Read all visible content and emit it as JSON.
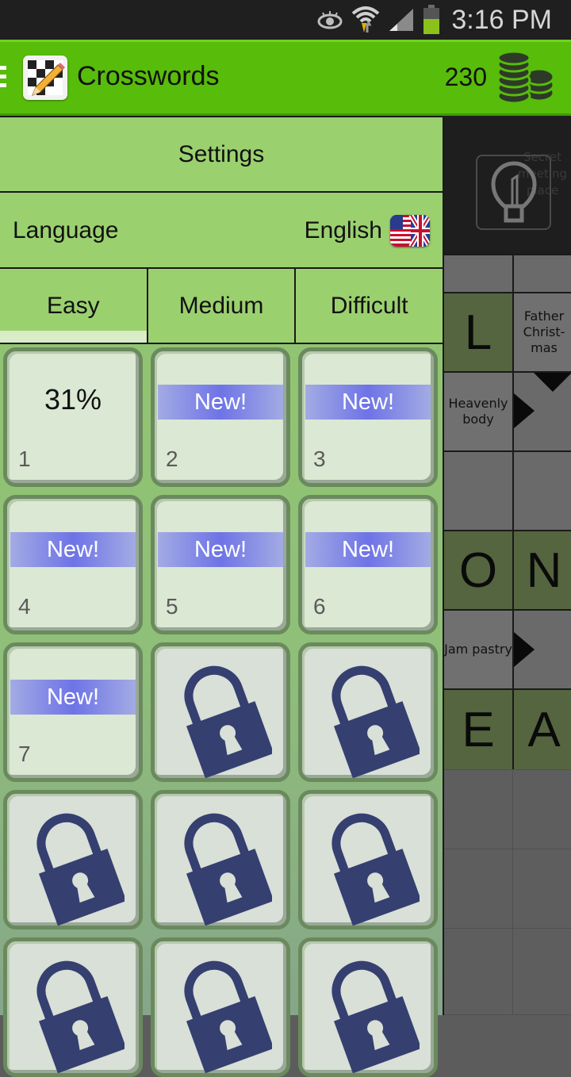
{
  "status_bar": {
    "time": "3:16 PM",
    "icons": [
      "eye-icon",
      "wifi-icon",
      "signal-icon",
      "battery-icon"
    ]
  },
  "app_bar": {
    "title": "Crosswords",
    "coins": "230",
    "menu_icon": "hamburger-icon",
    "logo_icon": "crossword-pencil-logo",
    "coins_icon": "coin-stack-icon"
  },
  "drawer": {
    "settings_label": "Settings",
    "language_label": "Language",
    "language_value": "English",
    "language_flag": "us-uk-flag-icon",
    "tabs": [
      {
        "label": "Easy",
        "selected": true
      },
      {
        "label": "Medium",
        "selected": false
      },
      {
        "label": "Difficult",
        "selected": false
      }
    ],
    "puzzles": [
      {
        "number": "1",
        "status": "progress",
        "progress": "31%"
      },
      {
        "number": "2",
        "status": "new",
        "badge": "New!"
      },
      {
        "number": "3",
        "status": "new",
        "badge": "New!"
      },
      {
        "number": "4",
        "status": "new",
        "badge": "New!"
      },
      {
        "number": "5",
        "status": "new",
        "badge": "New!"
      },
      {
        "number": "6",
        "status": "new",
        "badge": "New!"
      },
      {
        "number": "7",
        "status": "new",
        "badge": "New!"
      },
      {
        "status": "locked"
      },
      {
        "status": "locked"
      },
      {
        "status": "locked"
      },
      {
        "status": "locked"
      },
      {
        "status": "locked"
      },
      {
        "status": "locked"
      },
      {
        "status": "locked"
      },
      {
        "status": "locked"
      }
    ]
  },
  "puzzle_background": {
    "faint_clue": "Secret meeting place",
    "clues": {
      "father_christmas": "Father Christ- mas",
      "heavenly_body": "Heavenly body",
      "jam_pastry": "Jam pastry"
    },
    "letters": {
      "l": "L",
      "o": "O",
      "n": "N",
      "e": "E",
      "a": "A"
    }
  },
  "colors": {
    "app_bar": "#57bc0a",
    "drawer": "#9bd06f",
    "new_badge": "#6e73e6",
    "lock": "#353f70",
    "solved_cell": "#55653f"
  }
}
